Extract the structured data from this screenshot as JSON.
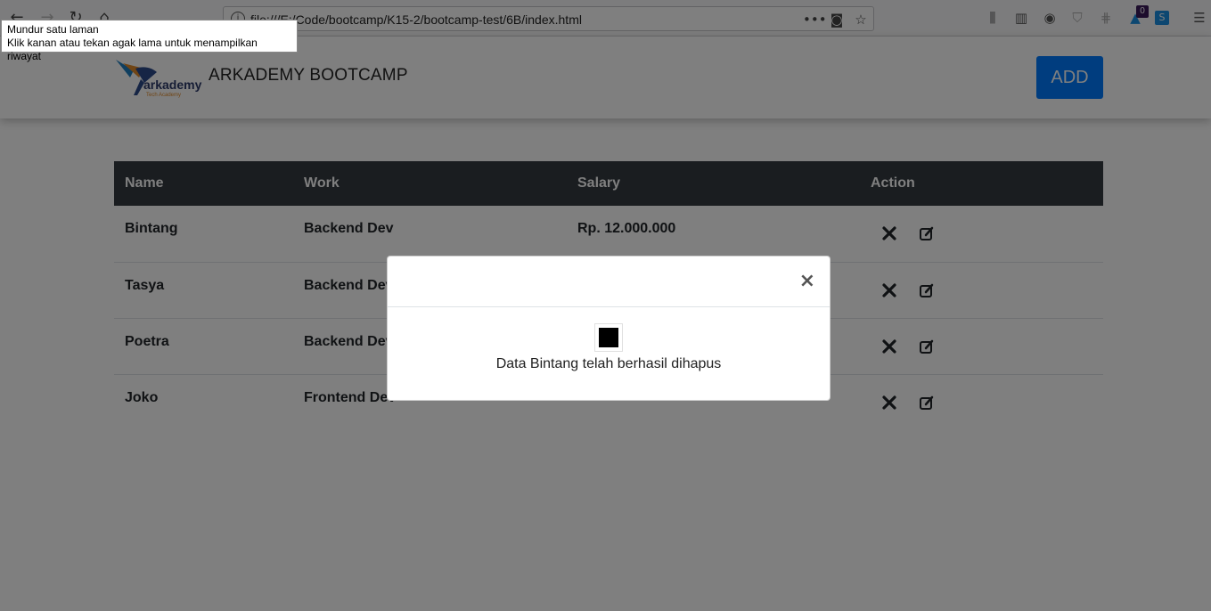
{
  "browser": {
    "url": "file:///E:/Code/bootcamp/K15-2/bootcamp-test/6B/index.html",
    "notification_count": "0",
    "tooltip": {
      "line1": "Mundur satu laman",
      "line2": "Klik kanan atau tekan agak lama untuk menampilkan riwayat"
    }
  },
  "navbar": {
    "logo_text": "arkademy",
    "logo_subtext": "Tech Academy",
    "brand": "ARKADEMY BOOTCAMP",
    "add_label": "ADD"
  },
  "table": {
    "headers": [
      "Name",
      "Work",
      "Salary",
      "Action"
    ],
    "rows": [
      {
        "name": "Bintang",
        "work": "Backend Dev",
        "salary": "Rp. 12.000.000"
      },
      {
        "name": "Tasya",
        "work": "Backend Dev",
        "salary": ""
      },
      {
        "name": "Poetra",
        "work": "Backend Dev",
        "salary": ""
      },
      {
        "name": "Joko",
        "work": "Frontend Dev",
        "salary": ""
      }
    ]
  },
  "modal": {
    "close_symbol": "×",
    "message": "Data Bintang telah berhasil dihapus"
  },
  "colors": {
    "primary": "#007bff",
    "table_header": "#343a40",
    "overlay": "rgba(0,0,0,0.5)"
  }
}
